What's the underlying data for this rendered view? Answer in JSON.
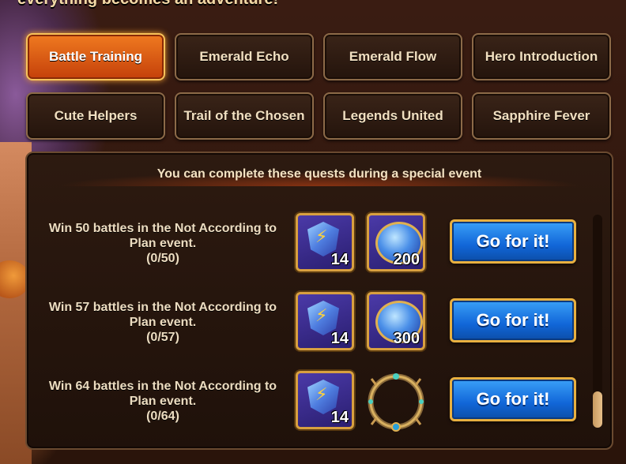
{
  "header": {
    "heading": "everything becomes an adventure!"
  },
  "tabs": [
    {
      "label": "Battle Training",
      "active": true
    },
    {
      "label": "Emerald Echo",
      "active": false
    },
    {
      "label": "Emerald Flow",
      "active": false
    },
    {
      "label": "Hero Introduction",
      "active": false
    },
    {
      "label": "Cute Helpers",
      "active": false
    },
    {
      "label": "Trail of the Chosen",
      "active": false
    },
    {
      "label": "Legends United",
      "active": false
    },
    {
      "label": "Sapphire Fever",
      "active": false
    }
  ],
  "panel": {
    "notice": "You can complete these quests during a special event",
    "quests": [
      {
        "line1": "Win 50 battles in the Not According to",
        "line2": "Plan event.",
        "progress": "(0/50)",
        "rewards": [
          {
            "icon": "lightning-rune-icon",
            "qty": "14"
          },
          {
            "icon": "blue-orb-icon",
            "qty": "200"
          }
        ],
        "button": "Go for it!"
      },
      {
        "line1": "Win 57 battles in the Not According to",
        "line2": "Plan event.",
        "progress": "(0/57)",
        "rewards": [
          {
            "icon": "lightning-rune-icon",
            "qty": "14"
          },
          {
            "icon": "blue-orb-icon",
            "qty": "300"
          }
        ],
        "button": "Go for it!"
      },
      {
        "line1": "Win 64 battles in the Not According to",
        "line2": "Plan event.",
        "progress": "(0/64)",
        "rewards": [
          {
            "icon": "lightning-rune-icon",
            "qty": "14"
          },
          {
            "icon": "laurel-ring-icon",
            "qty": ""
          }
        ],
        "button": "Go for it!"
      }
    ]
  },
  "colors": {
    "active_tab": "#e0601a",
    "button_blue": "#1c78e8",
    "gold_border": "#d8a040"
  }
}
